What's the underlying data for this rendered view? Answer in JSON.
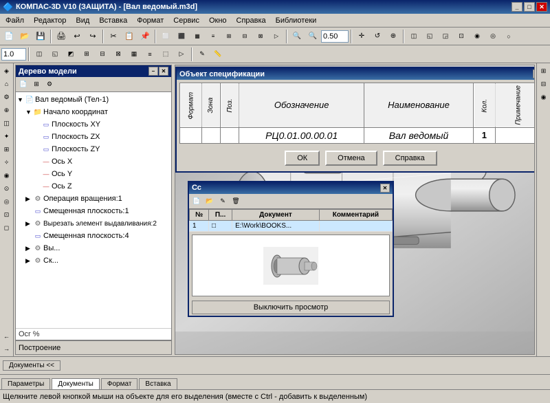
{
  "titlebar": {
    "text": "КОМПАС-3D V10 (ЗАЩИТА) - [Вал ведомый.m3d]",
    "controls": [
      "_",
      "□",
      "✕"
    ]
  },
  "menubar": {
    "items": [
      "Файл",
      "Редактор",
      "Вид",
      "Вставка",
      "Формат",
      "Сервис",
      "Окно",
      "Справка",
      "Библиотеки"
    ]
  },
  "toolbar1": {
    "zoom_value": "0.50",
    "scale_value": "1.0"
  },
  "sidebar": {
    "title": "Дерево модели",
    "close_btn": "✕",
    "pin_btn": "📌",
    "items": [
      {
        "label": "Вал ведомый (Тел-1)",
        "indent": 0,
        "icon": "doc",
        "expand": "▼"
      },
      {
        "label": "Начало координат",
        "indent": 1,
        "icon": "folder",
        "expand": "▼"
      },
      {
        "label": "Плоскость XY",
        "indent": 2,
        "icon": "plane",
        "expand": ""
      },
      {
        "label": "Плоскость ZX",
        "indent": 2,
        "icon": "plane",
        "expand": ""
      },
      {
        "label": "Плоскость ZY",
        "indent": 2,
        "icon": "plane",
        "expand": ""
      },
      {
        "label": "Ось X",
        "indent": 2,
        "icon": "axis",
        "expand": ""
      },
      {
        "label": "Ось Y",
        "indent": 2,
        "icon": "axis",
        "expand": ""
      },
      {
        "label": "Ось Z",
        "indent": 2,
        "icon": "axis",
        "expand": ""
      },
      {
        "label": "Операция вращения:1",
        "indent": 1,
        "icon": "gear",
        "expand": "▶"
      },
      {
        "label": "Смещенная плоскость:1",
        "indent": 1,
        "icon": "plane",
        "expand": ""
      },
      {
        "label": "Вырезать элемент выдавливания:2",
        "indent": 1,
        "icon": "gear",
        "expand": "▶"
      },
      {
        "label": "Смещенная плоскость:4",
        "indent": 1,
        "icon": "plane",
        "expand": ""
      },
      {
        "label": "Вы...",
        "indent": 1,
        "icon": "gear",
        "expand": "▶"
      },
      {
        "label": "Ск...",
        "indent": 1,
        "icon": "gear",
        "expand": "▶"
      }
    ]
  },
  "spec_dialog": {
    "title": "Объект спецификации",
    "close_btn": "✕",
    "columns": [
      "Формат",
      "Зона",
      "Поз.",
      "Обозначение",
      "Наименование",
      "Кол.",
      "Примечание"
    ],
    "row": {
      "format": "",
      "zone": "",
      "pos": "",
      "designation": "РЦ0.01.00.00.01",
      "name": "Вал ведомый",
      "qty": "1",
      "note": ""
    },
    "buttons": [
      "ОК",
      "Отмена",
      "Справка"
    ]
  },
  "file_dialog": {
    "title": "Сс",
    "columns": [
      "№",
      "П...",
      "Документ",
      "Комментарий"
    ],
    "rows": [
      {
        "num": "1",
        "p": "□",
        "doc": "E:\\Work\\BOOKS...",
        "comment": ""
      }
    ],
    "preview_label": "Выключить просмотр"
  },
  "docs_panel": {
    "label": "Документы  <<",
    "tabs": [
      "Параметры",
      "Документы",
      "Формат",
      "Вставка"
    ]
  },
  "status_bar": {
    "text": "Щелкните левой кнопкой мыши на объекте для его выделения (вместе с Ctrl - добавить к выделенным)"
  },
  "build_label": "Построение",
  "ocr_text": "Ocr %"
}
